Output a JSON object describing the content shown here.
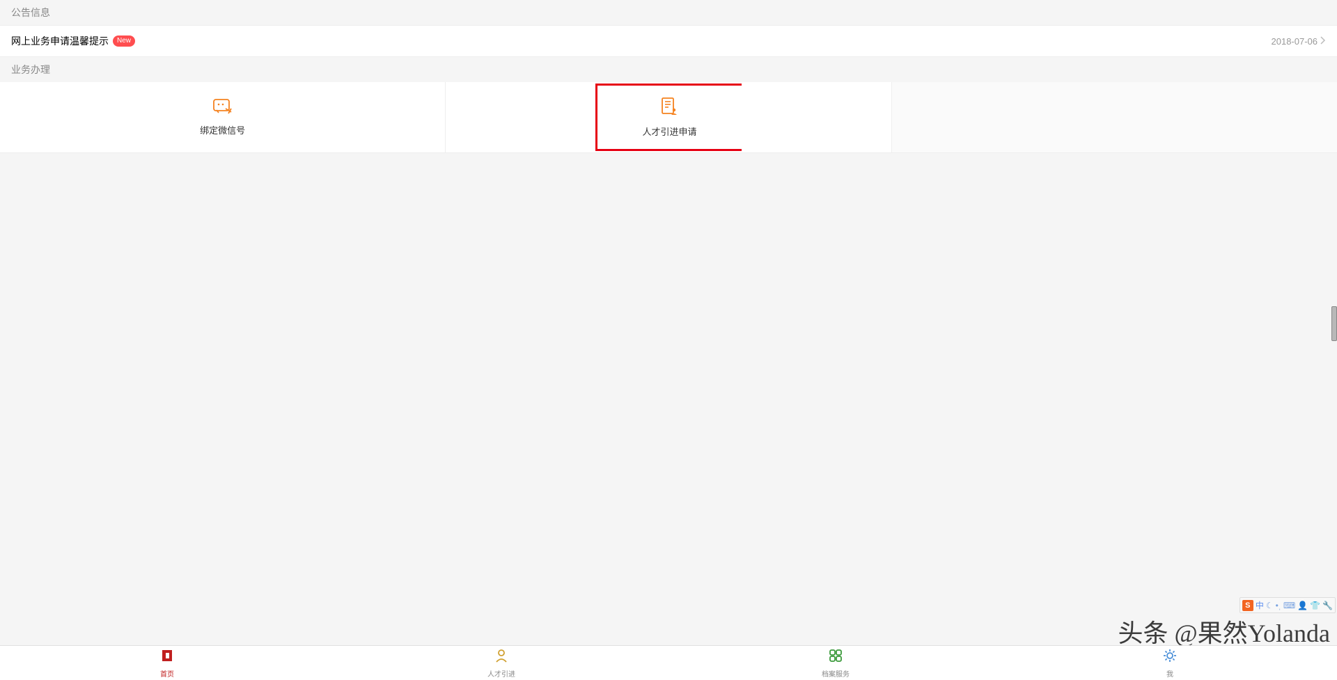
{
  "sections": {
    "announcement_header": "公告信息",
    "services_header": "业务办理"
  },
  "announcement": {
    "title": "网上业务申请温馨提示",
    "badge": "New",
    "date": "2018-07-06"
  },
  "services": {
    "bind_wechat": "绑定微信号",
    "talent_application": "人才引进申请"
  },
  "bottom_nav": {
    "home": "首页",
    "talent": "人才引进",
    "archive": "档案服务",
    "me": "我"
  },
  "watermark": "头条 @果然Yolanda",
  "ime": {
    "logo": "S",
    "lang": "中"
  }
}
